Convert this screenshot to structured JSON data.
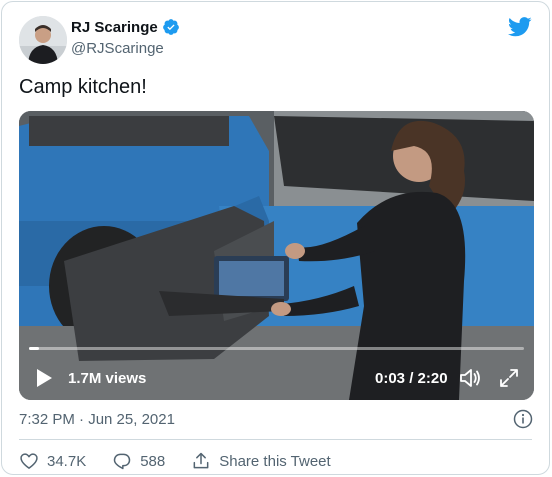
{
  "author": {
    "name": "RJ Scaringe",
    "handle": "@RJScaringe",
    "verified": true
  },
  "tweet": {
    "text": "Camp kitchen!",
    "timestamp": "7:32 PM · Jun 25, 2021"
  },
  "video": {
    "views": "1.7M views",
    "time": "0:03 / 2:20",
    "progress_fraction": 0.02
  },
  "actions": {
    "likes": "34.7K",
    "replies": "588",
    "share_label": "Share this Tweet"
  },
  "icons": {
    "brand": "twitter-bird-icon",
    "verified": "verified-badge-icon",
    "play": "play-icon",
    "volume": "volume-icon",
    "fullscreen": "fullscreen-icon",
    "info": "info-icon",
    "like": "heart-icon",
    "reply": "reply-bubble-icon",
    "share": "share-icon"
  },
  "colors": {
    "twitter_blue": "#1d9bf0",
    "secondary_text": "#536471",
    "primary_text": "#0f1419"
  }
}
